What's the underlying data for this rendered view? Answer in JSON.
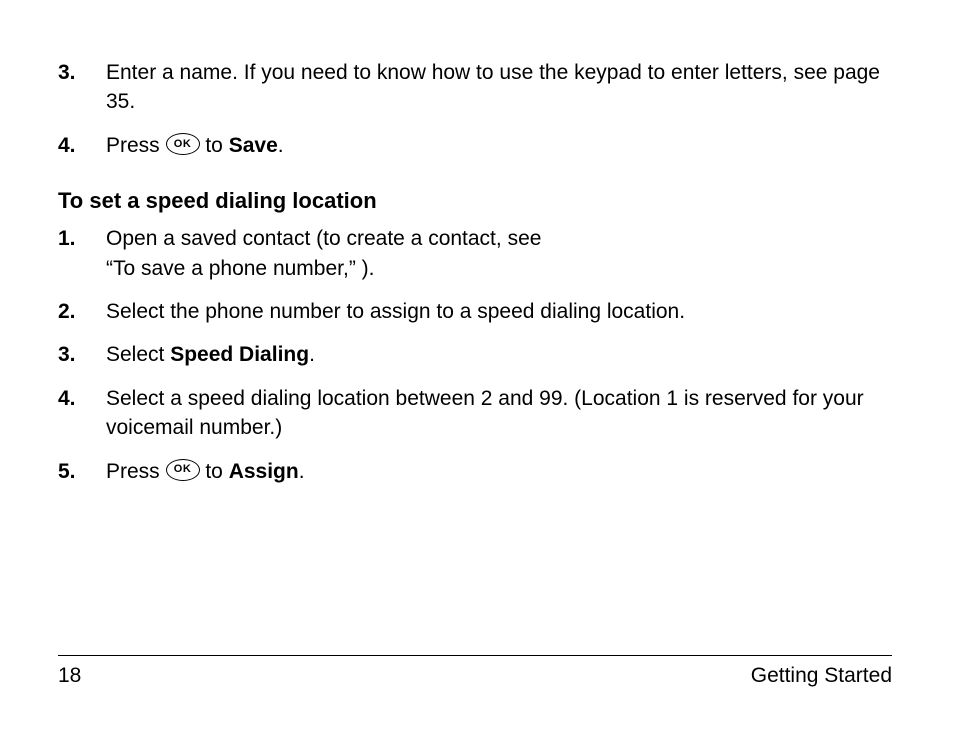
{
  "listA": {
    "items": [
      {
        "num": "3.",
        "text": "Enter a name. If you need to know how to use the keypad to enter letters, see page 35."
      },
      {
        "num": "4.",
        "pre": "Press ",
        "ok": "OK",
        "mid": " to ",
        "bold": "Save",
        "post": "."
      }
    ]
  },
  "heading": "To set a speed dialing location",
  "listB": {
    "items": [
      {
        "num": "1.",
        "line1": "Open a saved contact (to create a contact, see",
        "line2": "“To save a phone number,” )."
      },
      {
        "num": "2.",
        "text": "Select the phone number to assign to a speed dialing location."
      },
      {
        "num": "3.",
        "pre": "Select ",
        "bold": "Speed Dialing",
        "post": "."
      },
      {
        "num": "4.",
        "text": "Select a speed dialing location between 2 and 99. (Location 1 is reserved for your voicemail number.)"
      },
      {
        "num": "5.",
        "pre": "Press ",
        "ok": "OK",
        "mid": " to ",
        "bold": "Assign",
        "post": "."
      }
    ]
  },
  "footer": {
    "page": "18",
    "section": "Getting Started"
  }
}
